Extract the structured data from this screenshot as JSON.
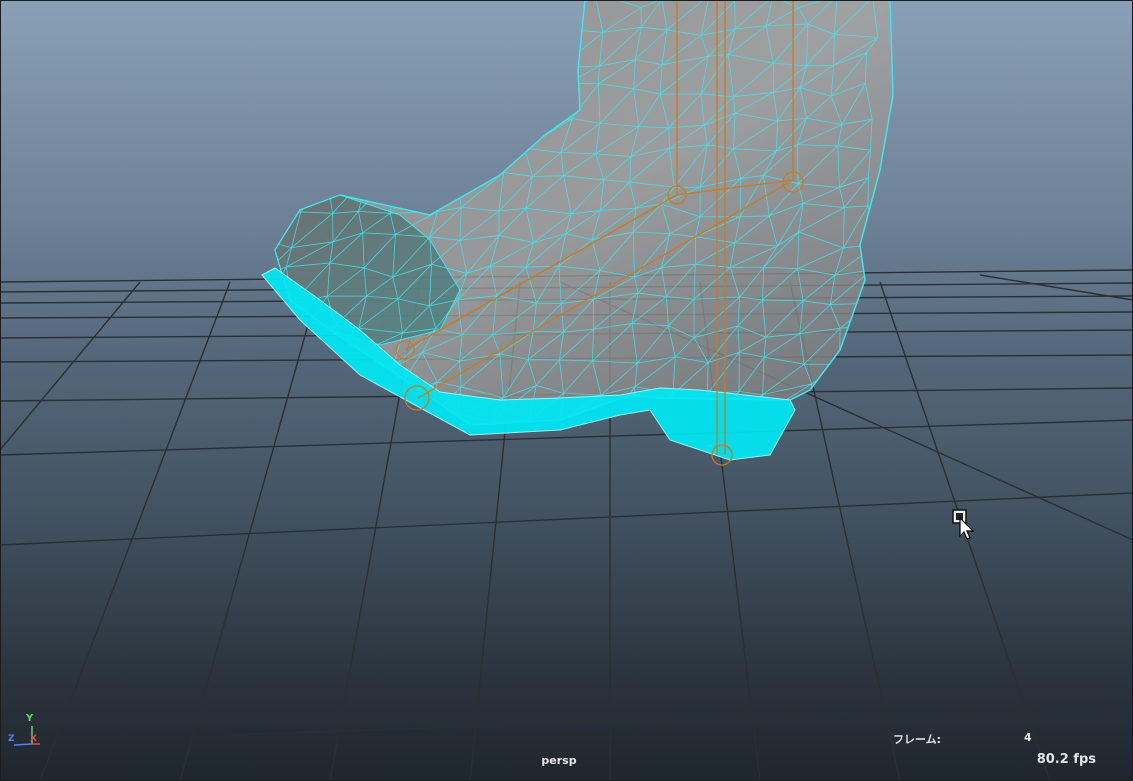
{
  "viewport": {
    "camera_label": "persp",
    "frame_label": "フレーム:",
    "frame_value": "4",
    "fps_readout": "80.2 fps"
  },
  "axis_indicator": {
    "y": "Y",
    "x": "X",
    "z": "Z"
  },
  "colors": {
    "wireframe": "#3fe6f0",
    "joint": "#c97a1e",
    "selected_faces": "#00e8f5",
    "grid_line": "#2a2f33",
    "viewport_top": "#8aa0b6",
    "viewport_bottom": "#1f262d"
  },
  "icons": {
    "cursor": "arrow-cursor-icon",
    "axis": "axis-gizmo-icon"
  }
}
